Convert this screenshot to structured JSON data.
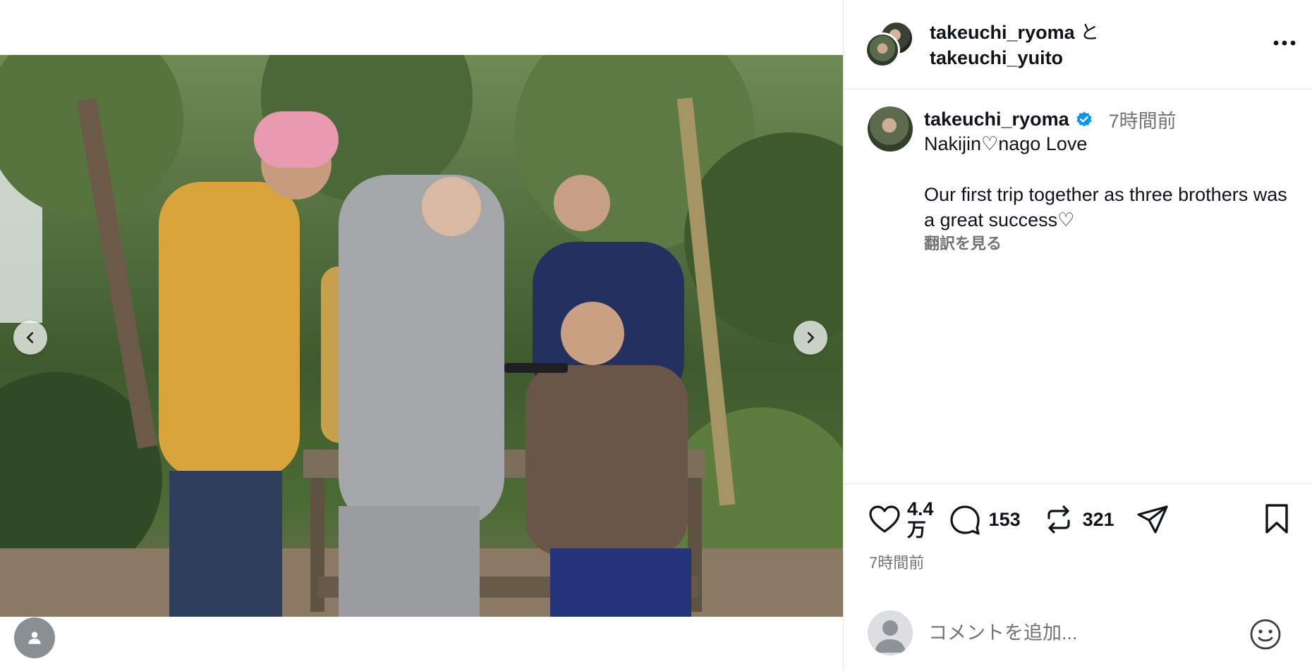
{
  "header": {
    "author_1": "takeuchi_ryoma",
    "conjunction": "と",
    "author_2": "takeuchi_yuito"
  },
  "caption": {
    "username": "takeuchi_ryoma",
    "time": "7時間前",
    "line_1": "Nakijin♡nago  Love",
    "line_2": "Our first trip together as three brothers was a great success♡",
    "translate_label": "翻訳を見る"
  },
  "stats": {
    "likes_top": "4.4",
    "likes_unit": "万",
    "comments": "153",
    "reposts": "321"
  },
  "post_time": "7時間前",
  "comment_box": {
    "placeholder": "コメントを追加..."
  },
  "icons": {
    "prev": "chevron-left-icon",
    "next": "chevron-right-icon",
    "tag": "person-icon",
    "more": "more-horizontal-icon",
    "verified": "verified-badge-icon",
    "like": "heart-icon",
    "comment": "comment-bubble-icon",
    "repost": "repost-icon",
    "share": "paper-plane-icon",
    "save": "bookmark-icon",
    "emoji": "smiley-icon"
  },
  "colors": {
    "verified_blue": "#0095f6",
    "text_primary": "#0f1419",
    "text_secondary": "#737373",
    "divider": "#e6e6e6"
  }
}
